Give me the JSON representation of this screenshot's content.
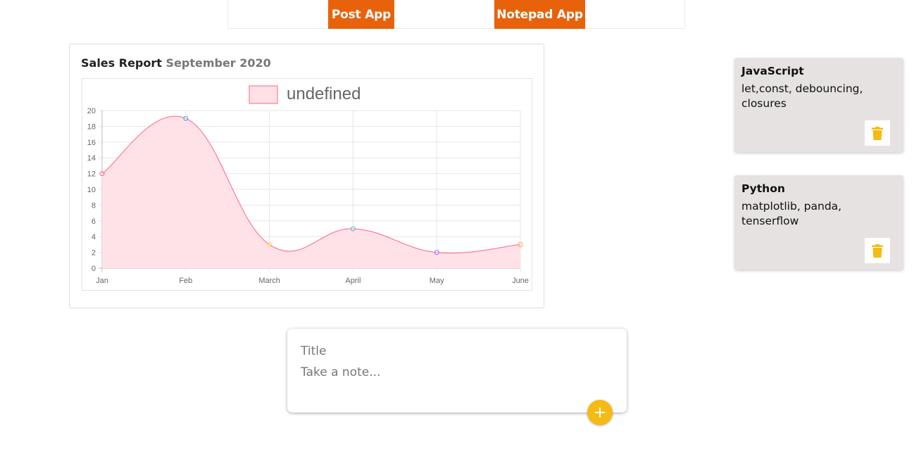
{
  "nav": {
    "post_app": "Post App",
    "notepad_app": "Notepad App"
  },
  "chart_card": {
    "title": "Sales Report",
    "subtitle": "September 2020"
  },
  "chart_data": {
    "type": "area",
    "categories": [
      "Jan",
      "Feb",
      "March",
      "April",
      "May",
      "June"
    ],
    "series": [
      {
        "name": "undefined",
        "values": [
          12,
          19,
          3,
          5,
          2,
          3
        ],
        "line_color": "#ff6384",
        "fill_color": "#ffe0e6",
        "point_colors": [
          "#ff6384",
          "#36a2eb",
          "#ffce56",
          "#4bc0c0",
          "#9966ff",
          "#ff9f40"
        ]
      }
    ],
    "legend": "top",
    "ylim": [
      0,
      20
    ],
    "yticks": [
      0,
      2,
      4,
      6,
      8,
      10,
      12,
      14,
      16,
      18,
      20
    ],
    "grid": true,
    "xlabel": "",
    "ylabel": ""
  },
  "notes": [
    {
      "title": "JavaScript",
      "content": "let,const, debouncing, closures"
    },
    {
      "title": "Python",
      "content": "matplotlib, panda, tenserflow"
    }
  ],
  "create_note": {
    "title_placeholder": "Title",
    "content_placeholder": "Take a note..."
  },
  "icons": {
    "delete": "trash-icon",
    "add": "plus-icon"
  },
  "colors": {
    "nav_accent": "#e8620c",
    "note_bg": "#e5e2e1",
    "action_yellow": "#f5ba13"
  }
}
